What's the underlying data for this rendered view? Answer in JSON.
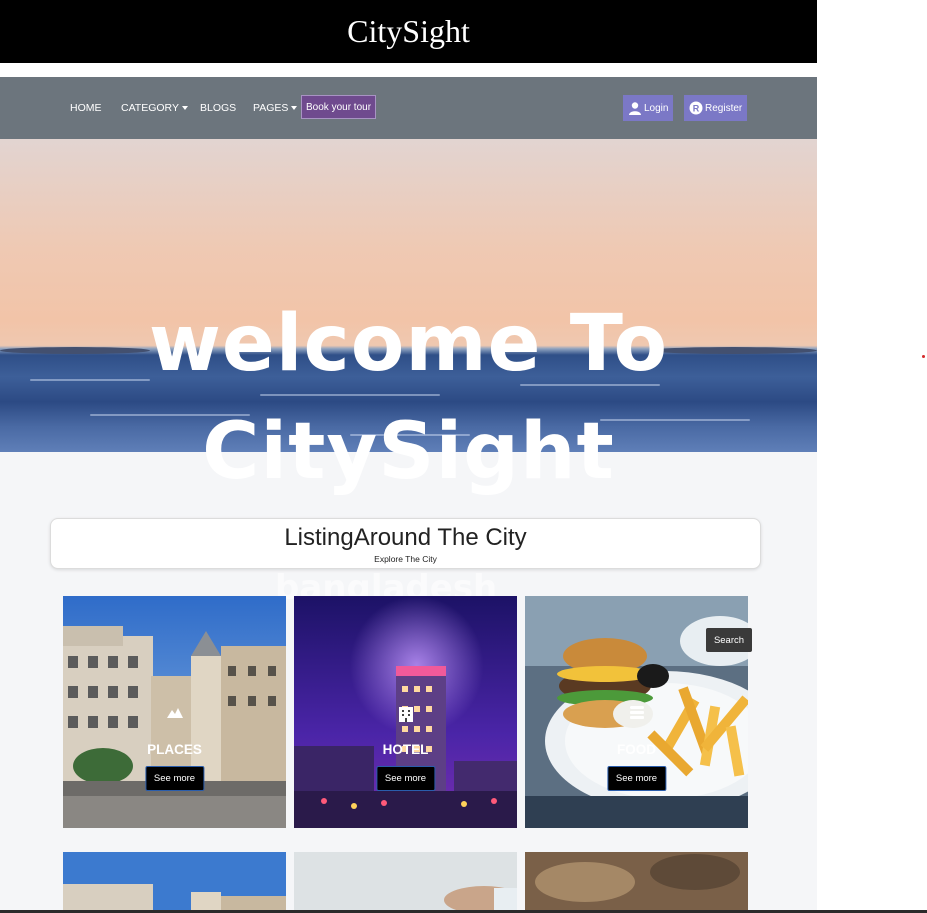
{
  "site": {
    "brand": "CitySight"
  },
  "nav": {
    "home": "HOME",
    "category": "CATEGORY",
    "blogs": "BLOGS",
    "pages": "PAGES",
    "book_tour": "Book your tour",
    "login": "Login",
    "register": "Register"
  },
  "hero": {
    "line1": "welcome To",
    "line2": "CitySight"
  },
  "listing": {
    "title": "ListingAround The City",
    "subtitle": "Explore The City",
    "ghost_text": "bangladesh"
  },
  "search_label": "Search",
  "cards": [
    {
      "label": "PLACES",
      "button": "See more",
      "icon": "landscape-icon"
    },
    {
      "label": "HOTEL",
      "button": "See more",
      "icon": "hotel-building-icon"
    },
    {
      "label": "FOOD",
      "button": "See more",
      "icon": "food-stack-icon"
    }
  ],
  "colors": {
    "topbar": "#000000",
    "navbar": "#6c757d",
    "book_button": "#6f4a8e",
    "auth_button": "#7b78c6",
    "see_more_border": "#2a5dac"
  }
}
